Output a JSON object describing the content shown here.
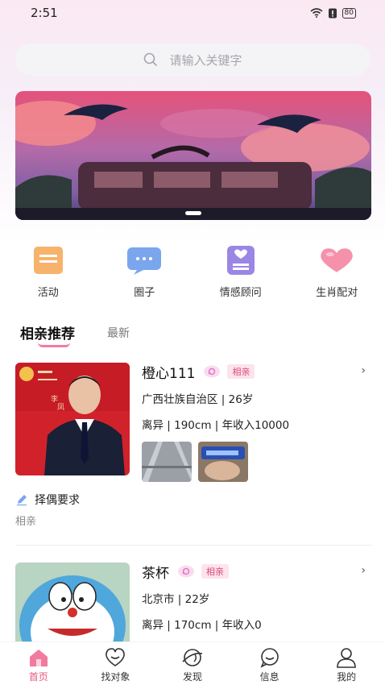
{
  "status": {
    "time": "2:51",
    "battery": "80"
  },
  "search": {
    "placeholder": "请输入关键字"
  },
  "quick": [
    {
      "label": "活动",
      "icon": "activity-icon"
    },
    {
      "label": "圈子",
      "icon": "chat-circle-icon"
    },
    {
      "label": "情感顾问",
      "icon": "advisor-icon"
    },
    {
      "label": "生肖配对",
      "icon": "heart-icon"
    }
  ],
  "tabs": {
    "active": "相亲推荐",
    "other": "最新"
  },
  "cards": [
    {
      "name": "橙心111",
      "tag": "相亲",
      "location_age": "广西壮族自治区 | 26岁",
      "details": "离异 | 190cm | 年收入10000",
      "photo_text": [
        "李",
        "凤"
      ]
    },
    {
      "name": "茶杯",
      "tag": "相亲",
      "location_age": "北京市 | 22岁",
      "details": "离异 | 170cm | 年收入0"
    }
  ],
  "requirements": {
    "title": "择偶要求",
    "value": "相亲"
  },
  "nav": [
    {
      "label": "首页",
      "icon": "home-icon"
    },
    {
      "label": "找对象",
      "icon": "find-match-icon"
    },
    {
      "label": "发现",
      "icon": "discover-icon"
    },
    {
      "label": "信息",
      "icon": "message-icon"
    },
    {
      "label": "我的",
      "icon": "profile-icon"
    }
  ],
  "colors": {
    "accent": "#e8567e",
    "tag_bg": "#fde3ec"
  }
}
